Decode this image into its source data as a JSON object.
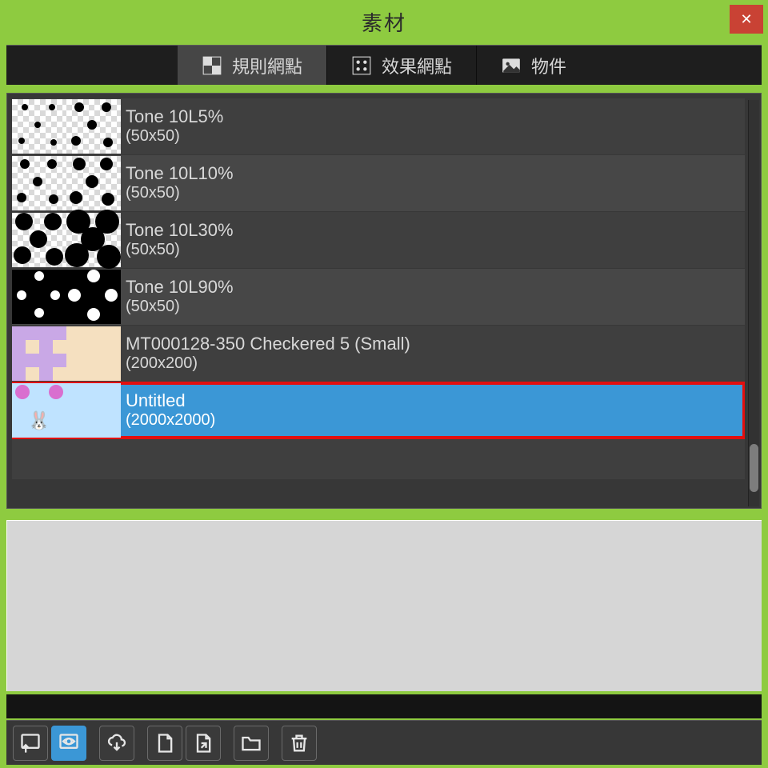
{
  "window": {
    "title": "素材"
  },
  "tabs": [
    {
      "label": "規則網點",
      "icon": "checker-icon",
      "active": true
    },
    {
      "label": "效果網點",
      "icon": "dotgrid-icon",
      "active": false
    },
    {
      "label": "物件",
      "icon": "image-icon",
      "active": false
    }
  ],
  "materials": [
    {
      "name": "Tone 10L5%",
      "dims": "(50x50)",
      "variant": "tone5",
      "selected": false
    },
    {
      "name": "Tone 10L10%",
      "dims": "(50x50)",
      "variant": "tone10",
      "selected": false
    },
    {
      "name": "Tone 10L30%",
      "dims": "(50x50)",
      "variant": "tone30",
      "selected": false
    },
    {
      "name": "Tone 10L90%",
      "dims": "(50x50)",
      "variant": "tone90",
      "selected": false
    },
    {
      "name": "MT000128-350 Checkered 5 (Small)",
      "dims": "(200x200)",
      "variant": "check5",
      "selected": false
    },
    {
      "name": "Untitled",
      "dims": "(2000x2000)",
      "variant": "untitled",
      "selected": true
    }
  ],
  "toolbar": {
    "new_window": "apply-to-canvas",
    "view": "preview",
    "cloud_down": "download-from-cloud",
    "blank": "new-material",
    "export": "export-material",
    "folder": "open-folder",
    "trash": "delete"
  },
  "colors": {
    "accent": "#3b97d6",
    "chrome": "#8ecb40",
    "danger": "#c94234"
  }
}
